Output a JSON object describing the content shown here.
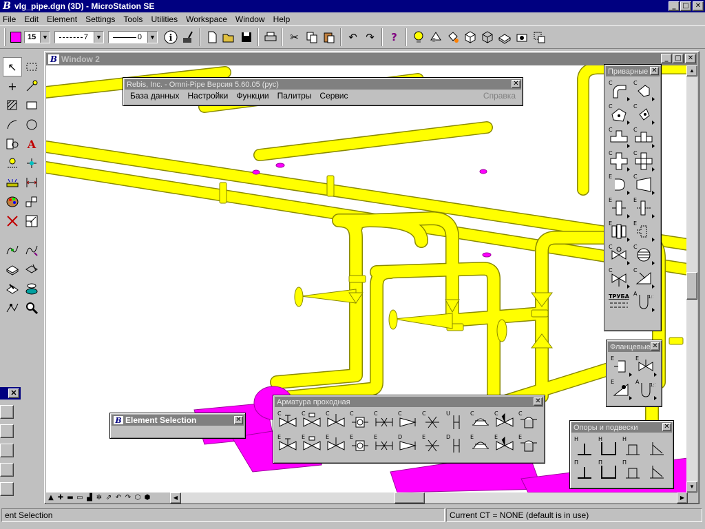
{
  "titlebar": {
    "title": "vlg_pipe.dgn (3D) - MicroStation SE",
    "logo": "B",
    "min": "_",
    "max": "□",
    "close": "✕"
  },
  "menu": [
    "File",
    "Edit",
    "Element",
    "Settings",
    "Tools",
    "Utilities",
    "Workspace",
    "Window",
    "Help"
  ],
  "toolbar": {
    "active_color_hex": "#ff00ff",
    "level": "15",
    "line_style": "7",
    "line_weight": "0"
  },
  "window2": {
    "title": "Window 2",
    "logo": "B"
  },
  "omnipipe": {
    "title": "Rebis, Inc. - Omni-Pipe Версия 5.60.05 (рус)",
    "menu": [
      "База данных",
      "Настройки",
      "Функции",
      "Палитры",
      "Сервис"
    ],
    "help": "Справка",
    "close": "✕"
  },
  "elem_sel": {
    "title": "Element Selection",
    "close": "✕"
  },
  "privarnye": {
    "title": "Приварные",
    "close": "✕",
    "letters": [
      "C",
      "C",
      "C",
      "C",
      "C",
      "C",
      "C",
      "C",
      "E",
      "C",
      "E",
      "E",
      "E",
      "E",
      "C",
      "C",
      "C",
      "C",
      "ТРУБА",
      "A"
    ]
  },
  "flantsevye": {
    "title": "Фланцевые",
    "close": "✕",
    "letters": [
      "E",
      "E",
      "E",
      "A"
    ]
  },
  "armatura": {
    "title": "Арматура проходная",
    "close": "✕",
    "row1": [
      "C",
      "C",
      "C",
      "C",
      "C",
      "C",
      "C",
      "U",
      "C",
      "C",
      "C"
    ],
    "row2": [
      "E",
      "E",
      "E",
      "E",
      "E",
      "D",
      "E",
      "D",
      "E",
      "E",
      "E"
    ]
  },
  "opory": {
    "title": "Опоры и подвески",
    "close": "✕",
    "row1": [
      "H",
      "H",
      "H",
      ""
    ],
    "row2": [
      "П",
      "П",
      "П",
      ""
    ]
  },
  "status": {
    "left": "ent Selection",
    "right": "Current CT = NONE (default is in use)"
  },
  "leftpanel": {
    "close": "✕"
  },
  "colors": {
    "pipe": "#ffff00",
    "equipment": "#ff00ff",
    "title_active": "#000080",
    "title_inactive": "#808080"
  }
}
